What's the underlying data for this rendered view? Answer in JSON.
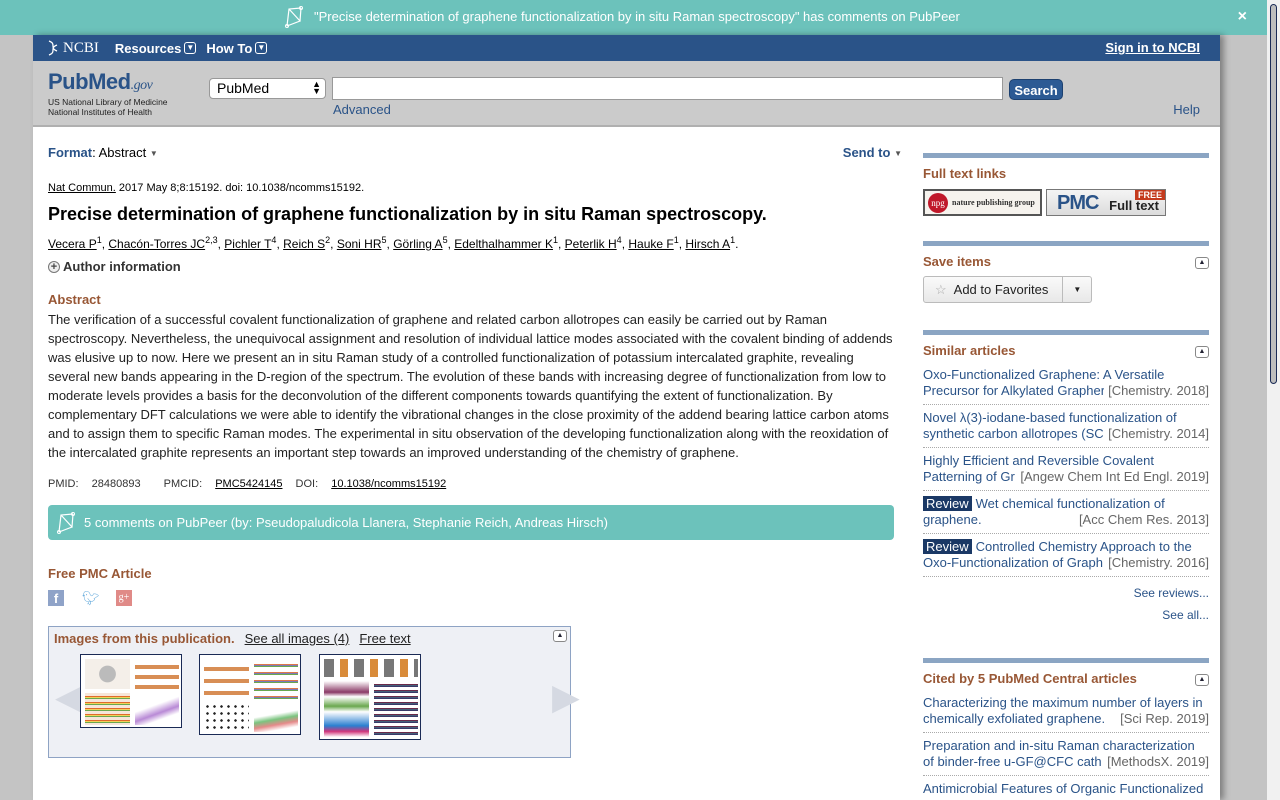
{
  "banner": {
    "message": "\"Precise determination of graphene functionalization by in situ Raman spectroscopy\" has comments on PubPeer",
    "close_label": "×",
    "color": "#6cc2bb"
  },
  "ncbi": {
    "logo": "NCBI",
    "menus": [
      "Resources",
      "How To"
    ],
    "signin": "Sign in to NCBI",
    "color": "#2a5388"
  },
  "header": {
    "logo_pub": "Pub",
    "logo_med": "Med",
    "logo_gov": ".gov",
    "logo_line1": "US National Library of Medicine",
    "logo_line2": "National Institutes of Health",
    "db_selected": "PubMed",
    "search_value": "",
    "search_button": "Search",
    "advanced": "Advanced",
    "help": "Help"
  },
  "main": {
    "format_label": "Format",
    "format_value": "Abstract",
    "send_to": "Send to",
    "citation": {
      "journal": "Nat Commun.",
      "rest": " 2017 May 8;8:15192. doi: 10.1038/ncomms15192."
    },
    "title": "Precise determination of graphene functionalization by in situ Raman spectroscopy.",
    "authors": [
      {
        "name": "Vecera P",
        "aff": "1"
      },
      {
        "name": "Chacón-Torres JC",
        "aff": "2,3"
      },
      {
        "name": "Pichler T",
        "aff": "4"
      },
      {
        "name": "Reich S",
        "aff": "2"
      },
      {
        "name": "Soni HR",
        "aff": "5"
      },
      {
        "name": "Görling A",
        "aff": "5"
      },
      {
        "name": "Edelthalhammer K",
        "aff": "1"
      },
      {
        "name": "Peterlik H",
        "aff": "4"
      },
      {
        "name": "Hauke F",
        "aff": "1"
      },
      {
        "name": "Hirsch A",
        "aff": "1"
      }
    ],
    "author_info": "Author information",
    "abstract_heading": "Abstract",
    "abstract": "The verification of a successful covalent functionalization of graphene and related carbon allotropes can easily be carried out by Raman spectroscopy. Nevertheless, the unequivocal assignment and resolution of individual lattice modes associated with the covalent binding of addends was elusive up to now. Here we present an in situ Raman study of a controlled functionalization of potassium intercalated graphite, revealing several new bands appearing in the D-region of the spectrum. The evolution of these bands with increasing degree of functionalization from low to moderate levels provides a basis for the deconvolution of the different components towards quantifying the extent of functionalization. By complementary DFT calculations we were able to identify the vibrational changes in the close proximity of the addend bearing lattice carbon atoms and to assign them to specific Raman modes. The experimental in situ observation of the developing functionalization along with the reoxidation of the intercalated graphite represents an important step towards an improved understanding of the chemistry of graphene.",
    "ids": {
      "pmid_label": "PMID:",
      "pmid": "28480893",
      "pmcid_label": "PMCID:",
      "pmcid": "PMC5424145",
      "doi_label": "DOI:",
      "doi": "10.1038/ncomms15192"
    },
    "pubpeer": "5 comments on PubPeer (by: Pseudopaludicola Llanera, Stephanie Reich, Andreas Hirsch)",
    "free_pmc": "Free PMC Article",
    "social": [
      "facebook",
      "twitter",
      "google-plus"
    ],
    "images": {
      "heading": "Images from this publication.",
      "see_all": "See all images (4)",
      "free_text": "Free text",
      "thumbnail_count": 3
    }
  },
  "side": {
    "full_text": {
      "heading": "Full text links",
      "npg_logo": "npg",
      "npg_label": "nature publishing group",
      "pmc_logo": "PMC",
      "pmc_label": "Full text",
      "pmc_badge": "FREE"
    },
    "save_items": {
      "heading": "Save items",
      "button": "Add to Favorites"
    },
    "similar": {
      "heading": "Similar articles",
      "items": [
        {
          "review": "",
          "line1": "Oxo-Functionalized Graphene: A Versatile",
          "line2": "Precursor for Alkylated Grapher",
          "source": "[Chemistry. 2018]"
        },
        {
          "review": "",
          "line1": "Novel λ(3)-iodane-based functionalization of",
          "line2": "synthetic carbon allotropes (SC",
          "source": "[Chemistry. 2014]"
        },
        {
          "review": "",
          "line1": "Highly Efficient and Reversible Covalent",
          "line2": "Patterning of Gr",
          "source": "[Angew Chem Int Ed Engl. 2019]"
        },
        {
          "review": "Review",
          "line1": "Wet chemical functionalization of",
          "line2": "graphene.",
          "source": "[Acc Chem Res. 2013]"
        },
        {
          "review": "Review",
          "line1": "Controlled Chemistry Approach to the",
          "line2": "Oxo-Functionalization of Graph",
          "source": "[Chemistry. 2016]"
        }
      ],
      "see_reviews": "See reviews...",
      "see_all": "See all..."
    },
    "cited_by": {
      "heading": "Cited by 5 PubMed Central articles",
      "items": [
        {
          "line1": "Characterizing the maximum number of layers in",
          "line2": "chemically exfoliated graphene.",
          "source": "[Sci Rep. 2019]"
        },
        {
          "line1": "Preparation and in-situ Raman characterization",
          "line2": "of binder-free u-GF@CFC cath",
          "source": "[MethodsX. 2019]"
        },
        {
          "line1": "Antimicrobial Features of Organic Functionalized",
          "line2": "",
          "source": ""
        }
      ]
    }
  }
}
